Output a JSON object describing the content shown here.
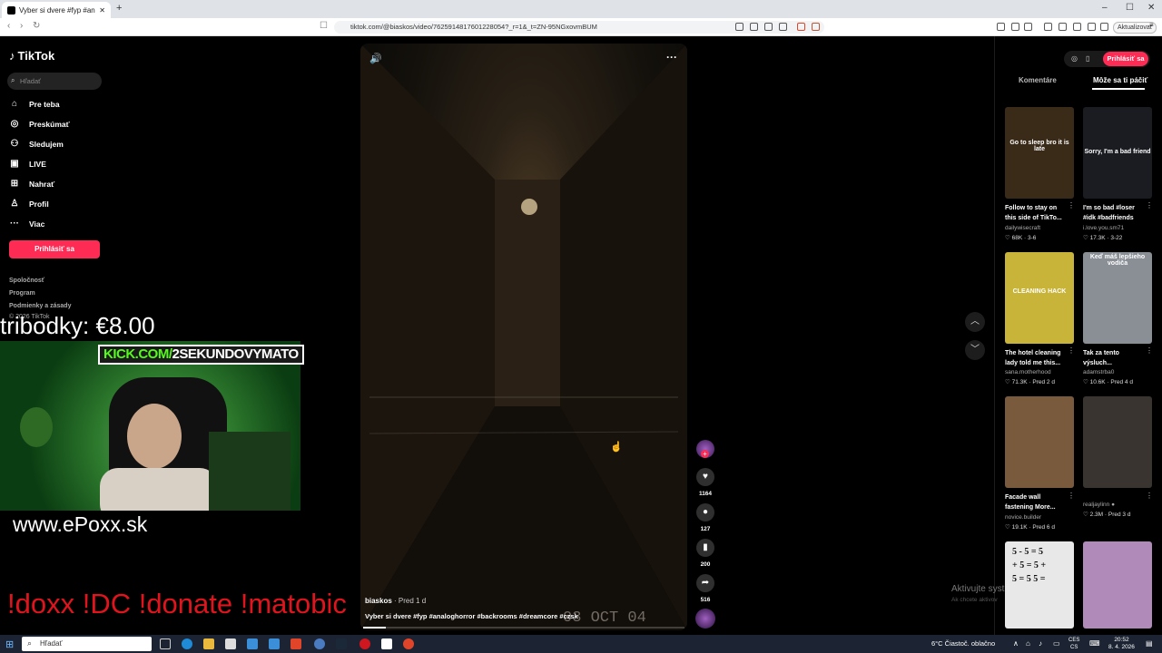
{
  "browser": {
    "tab_title": "Vyber si dvere #fyp #analogi",
    "new_tab": "+",
    "url": "tiktok.com/@biaskos/video/7625914817601228054?_r=1&_t=ZN-95NGxovmBUM",
    "update_label": "Aktualizovať",
    "win_min": "–",
    "win_max": "☐",
    "win_close": "✕"
  },
  "sidebar": {
    "logo": "TikTok",
    "search_placeholder": "Hľadať",
    "nav": [
      {
        "label": "Pre teba",
        "icon": "home-icon"
      },
      {
        "label": "Preskúmať",
        "icon": "compass-icon"
      },
      {
        "label": "Sledujem",
        "icon": "following-icon"
      },
      {
        "label": "LIVE",
        "icon": "live-icon"
      },
      {
        "label": "Nahrať",
        "icon": "upload-icon"
      },
      {
        "label": "Profil",
        "icon": "profile-icon"
      },
      {
        "label": "Viac",
        "icon": "more-icon"
      }
    ],
    "login": "Prihlásiť sa",
    "footer": [
      "Spoločnosť",
      "Program",
      "Podmienky a zásady",
      "© 2026 TikTok"
    ]
  },
  "stream": {
    "donations": "tribodky: €8.00",
    "kick_prefix": "KICK.COM/",
    "kick_channel": "2SEKUNDOVYMATO",
    "website": "www.ePoxx.sk",
    "commands": "!doxx  !DC !donate !matobic"
  },
  "video": {
    "author": "biaskos",
    "posted": "· Pred 1 d",
    "caption": "Vyber si dvere #fyp #analoghorror #backrooms #dreamcore #czsk",
    "datestamp": "03 OCT 04",
    "progress": 0.07,
    "likes": "1164",
    "comments": "127",
    "saves": "200",
    "shares": "516"
  },
  "right": {
    "login": "Prihlásiť sa",
    "tab_comments": "Komentáre",
    "tab_maybe": "Môže sa ti páčiť",
    "cards": [
      {
        "overlay": "Go to sleep bro it is late",
        "title": "Follow to stay on this side of TikTo...",
        "user": "dailywisecraft",
        "stats": "♡ 68K · 3-6",
        "color": "#3a2a18"
      },
      {
        "overlay": "Sorry, I'm a bad friend",
        "title": "I'm so bad #loser #idk #badfriends",
        "user": "i.love.you.sm71",
        "stats": "♡ 17.3K · 3-22",
        "color": "#1a1c22"
      },
      {
        "overlay": "CLEANING HACK",
        "title": "The hotel cleaning lady told me this...",
        "user": "sana.motherhood",
        "stats": "♡ 71.3K · Pred 2 d",
        "color": "#c9b43a"
      },
      {
        "overlay": "Keď máš lepšieho vodiča",
        "title": "Tak za tento výsluch...",
        "user": "adamstrba0",
        "stats": "♡ 10.6K · Pred 4 d",
        "color": "#8a8f96"
      },
      {
        "overlay": "",
        "title": "Facade wall fastening More...",
        "user": "novice.builder",
        "stats": "♡ 19.1K · Pred 6 d",
        "color": "#7a5a3c"
      },
      {
        "overlay": "",
        "title": "",
        "user": "realjaylinn ●",
        "stats": "♡ 2.3M · Pred 3 d",
        "color": "#3a3430"
      },
      {
        "overlay": "5 - 5 =  5 + 5 =  5 + 5 =  5  5 =",
        "title": "",
        "user": "",
        "stats": "",
        "color": "#e8e8e8"
      },
      {
        "overlay": "",
        "title": "",
        "user": "",
        "stats": "",
        "color": "#b08ab8"
      }
    ],
    "activate1": "Aktivujte syst",
    "activate2": "Ak chcete aktivov"
  },
  "taskbar": {
    "search": "Hľadať",
    "weather": "6°C  Čiastoč. oblačno",
    "lang1": "CES",
    "lang2": "CS",
    "time": "20:52",
    "date": "8. 4. 2026"
  }
}
